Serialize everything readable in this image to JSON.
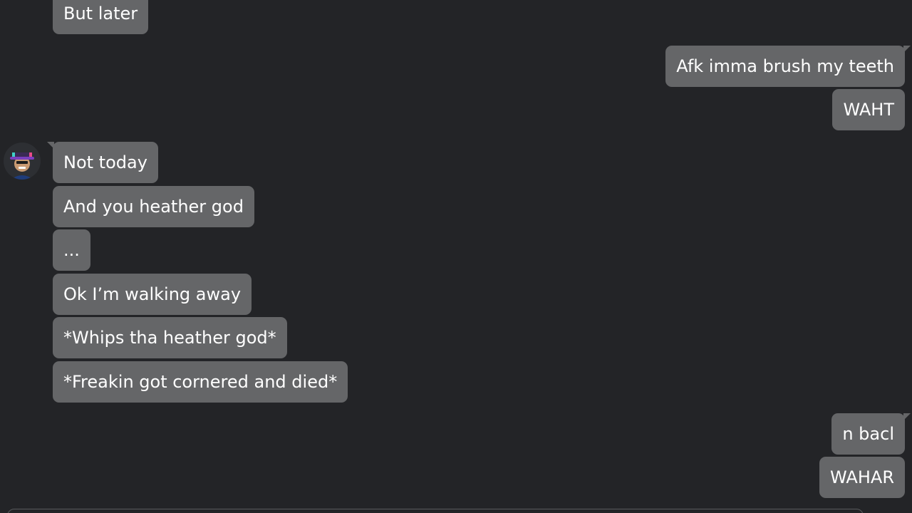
{
  "messages": [
    {
      "side": "left",
      "text": "But later"
    },
    {
      "side": "right",
      "text": "Afk imma brush my teeth"
    },
    {
      "side": "right",
      "text": "WAHT"
    },
    {
      "side": "left",
      "text": "Not today"
    },
    {
      "side": "left",
      "text": "And you heather god"
    },
    {
      "side": "left",
      "text": "..."
    },
    {
      "side": "left",
      "text": "Ok I’m walking away"
    },
    {
      "side": "left",
      "text": "*Whips tha heather god*"
    },
    {
      "side": "left",
      "text": "*Freakin got cornered and died*"
    },
    {
      "side": "right",
      "text": "n bacl"
    },
    {
      "side": "right",
      "text": "WAHAR"
    }
  ],
  "colors": {
    "background": "#232427",
    "bubble": "#656668",
    "text": "#ffffff"
  },
  "avatar_icon": "avatar-icon"
}
